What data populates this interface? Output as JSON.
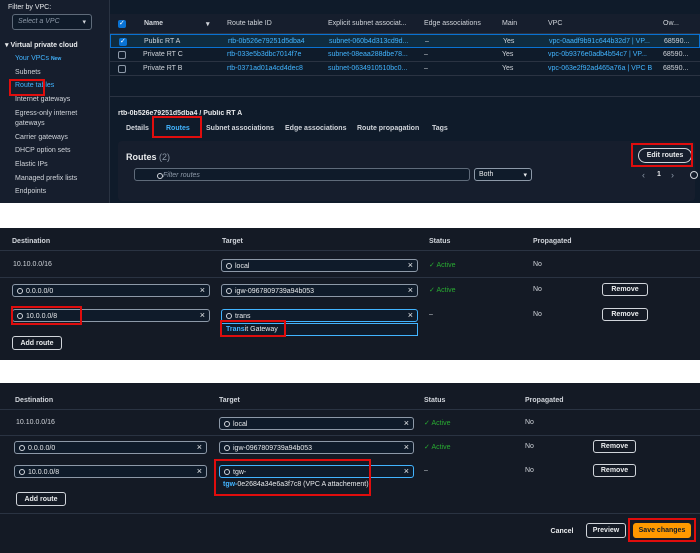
{
  "sidebar": {
    "filter_label": "Filter by VPC:",
    "vpc_placeholder": "Select a VPC",
    "section": "Virtual private cloud",
    "items": [
      {
        "label": "Your VPCs",
        "badge": "New"
      },
      {
        "label": "Subnets"
      },
      {
        "label": "Route tables"
      },
      {
        "label": "Internet gateways"
      },
      {
        "label": "Egress-only internet"
      },
      {
        "label": "gateways"
      },
      {
        "label": "Carrier gateways"
      },
      {
        "label": "DHCP option sets"
      },
      {
        "label": "Elastic IPs"
      },
      {
        "label": "Managed prefix lists"
      },
      {
        "label": "Endpoints"
      }
    ]
  },
  "table": {
    "columns": [
      "Name",
      "Route table ID",
      "Explicit subnet associat...",
      "Edge associations",
      "Main",
      "VPC",
      "Ow..."
    ],
    "rows": [
      {
        "name": "Public RT A",
        "id": "rtb-0b526e79251d5dba4",
        "subnet": "subnet-060b4d313cd9d...",
        "edge": "–",
        "main": "Yes",
        "vpc": "vpc-0aadf9b91c644b32d7 | VP...",
        "owner": "68590...",
        "selected": true
      },
      {
        "name": "Private RT C",
        "id": "rtb-033e5b3dbc7014f7e",
        "subnet": "subnet-08eaa288dbe78...",
        "edge": "–",
        "main": "Yes",
        "vpc": "vpc-0b9376e0adb4b54c7 | VP...",
        "owner": "68590...",
        "selected": false
      },
      {
        "name": "Private RT B",
        "id": "rtb-0371ad01a4cd4dec8",
        "subnet": "subnet-0634910510bc0...",
        "edge": "–",
        "main": "Yes",
        "vpc": "vpc-063e2f92ad465a76a | VPC B",
        "owner": "68590...",
        "selected": false
      }
    ]
  },
  "detail": {
    "title": "rtb-0b526e79251d5dba4 / Public RT A",
    "tabs": [
      "Details",
      "Routes",
      "Subnet associations",
      "Edge associations",
      "Route propagation",
      "Tags"
    ],
    "routes_title": "Routes",
    "routes_count": "(2)",
    "filter_placeholder": "Filter routes",
    "both": "Both",
    "edit_routes": "Edit routes",
    "page": "1"
  },
  "edit1": {
    "headers": [
      "Destination",
      "Target",
      "Status",
      "Propagated"
    ],
    "rows": [
      {
        "dest": "10.10.0.0/16",
        "target": "local",
        "status": "Active",
        "prop": "No"
      },
      {
        "dest": "0.0.0.0/0",
        "target": "igw-0967809739a94b053",
        "status": "Active",
        "prop": "No",
        "remove": "Remove"
      },
      {
        "dest": "10.0.0.0/8",
        "target": "trans",
        "status": "–",
        "prop": "No",
        "remove": "Remove"
      }
    ],
    "suggestion_hl": "Trans",
    "suggestion_rest": "it Gateway",
    "add_route": "Add route"
  },
  "edit2": {
    "headers": [
      "Destination",
      "Target",
      "Status",
      "Propagated"
    ],
    "rows": [
      {
        "dest": "10.10.0.0/16",
        "target": "local",
        "status": "Active",
        "prop": "No"
      },
      {
        "dest": "0.0.0.0/0",
        "target": "igw-0967809739a94b053",
        "status": "Active",
        "prop": "No",
        "remove": "Remove"
      },
      {
        "dest": "10.0.0.0/8",
        "target": "tgw-",
        "status": "–",
        "prop": "No",
        "remove": "Remove"
      }
    ],
    "suggestion_hl": "tgw-",
    "suggestion_rest": "0e2684a34e6a3f7c8 (VPC A attachement)",
    "add_route": "Add route",
    "cancel": "Cancel",
    "preview": "Preview",
    "save": "Save changes"
  },
  "colors": {
    "accent": "#42b4ff",
    "primary": "#ff9900",
    "highlight": "#e00d0d",
    "active": "#29ad32"
  }
}
